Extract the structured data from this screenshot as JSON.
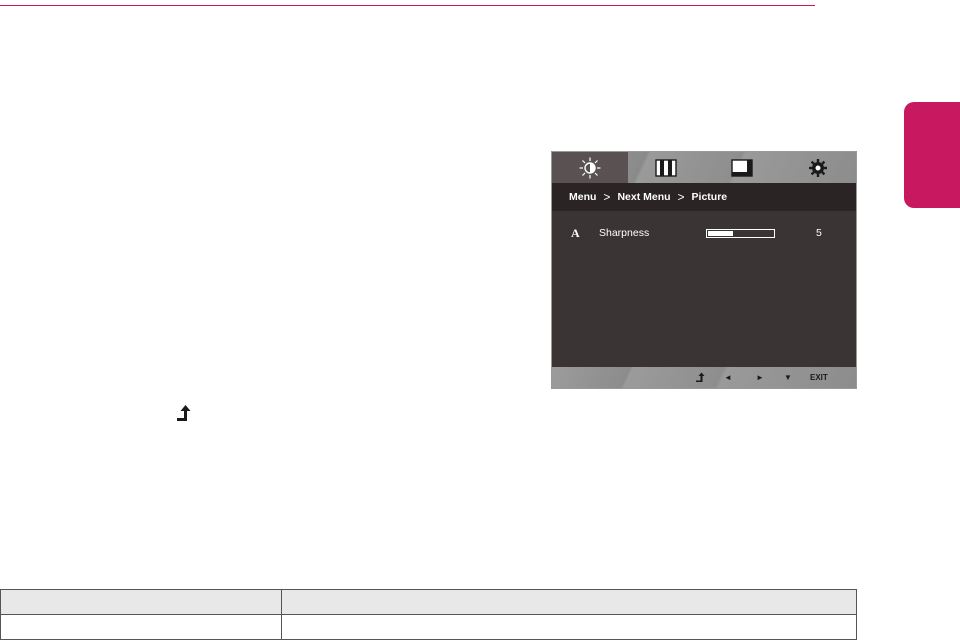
{
  "osd": {
    "tabs": [
      {
        "name": "picture-tab",
        "icon": "brightness-icon",
        "active": true
      },
      {
        "name": "color-tab",
        "icon": "color-bars-icon",
        "active": false
      },
      {
        "name": "display-tab",
        "icon": "screen-icon",
        "active": false
      },
      {
        "name": "settings-tab",
        "icon": "gear-icon",
        "active": false
      }
    ],
    "breadcrumb": {
      "menu": "Menu",
      "sep": ">",
      "next_menu": "Next Menu",
      "current": "Picture"
    },
    "item": {
      "icon_glyph": "A",
      "label": "Sharpness",
      "value": "5",
      "level_fraction": 0.38
    },
    "footer": {
      "left": "◄",
      "right": "►",
      "down": "▼",
      "exit": "EXIT"
    }
  },
  "colors": {
    "accent": "#c8185f",
    "osd_background": "#3b3434",
    "osd_bar": "#2a2424"
  }
}
